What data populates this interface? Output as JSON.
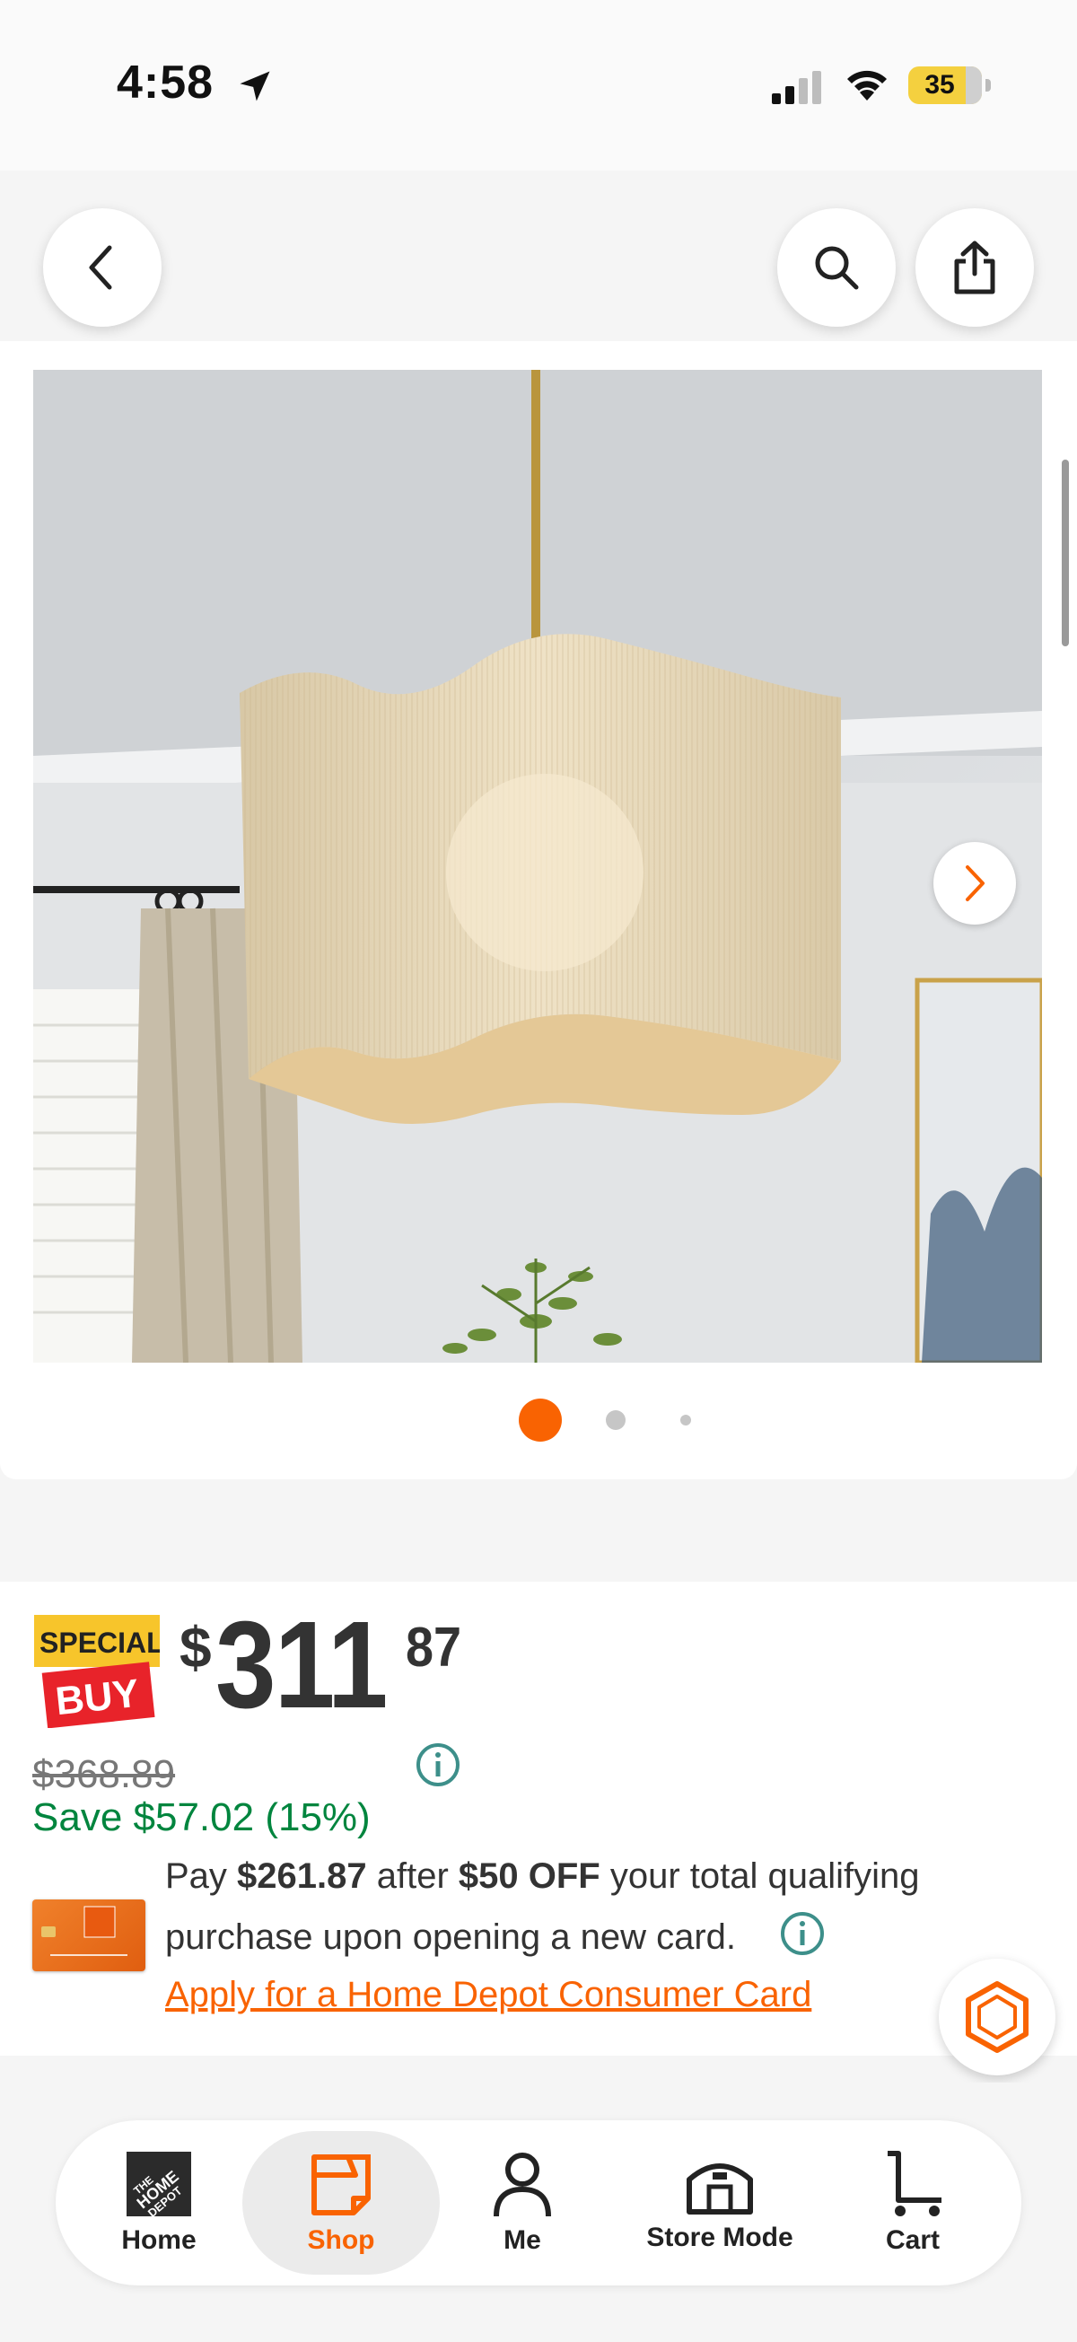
{
  "status_bar": {
    "time": "4:58",
    "battery": "35"
  },
  "product": {
    "image_alt": "Woven scalloped pendant light",
    "carousel": {
      "total": 3,
      "active": 0
    }
  },
  "price": {
    "badge_top": "SPECIAL",
    "badge_bottom": "BUY",
    "dollar_sign": "$",
    "dollars": "311",
    "cents": "87",
    "was": "$368.89",
    "save": "Save $57.02 (15%)"
  },
  "card_offer": {
    "pay_prefix": "Pay ",
    "pay_amount": "$261.87",
    "pay_mid": " after ",
    "discount": "$50 OFF",
    "pay_suffix": " your total qualifying",
    "line2": "purchase upon opening a new card.",
    "apply_link": "Apply for a Home Depot Consumer Card"
  },
  "bottom_nav": {
    "items": [
      {
        "label": "Home",
        "icon": "home-depot-logo-icon"
      },
      {
        "label": "Shop",
        "icon": "shop-icon",
        "active": true
      },
      {
        "label": "Me",
        "icon": "person-icon"
      },
      {
        "label": "Store Mode",
        "icon": "store-icon"
      },
      {
        "label": "Cart",
        "icon": "cart-icon"
      }
    ]
  },
  "colors": {
    "brand_orange": "#f96302",
    "save_green": "#00853e",
    "info_teal": "#3d8f8a"
  }
}
